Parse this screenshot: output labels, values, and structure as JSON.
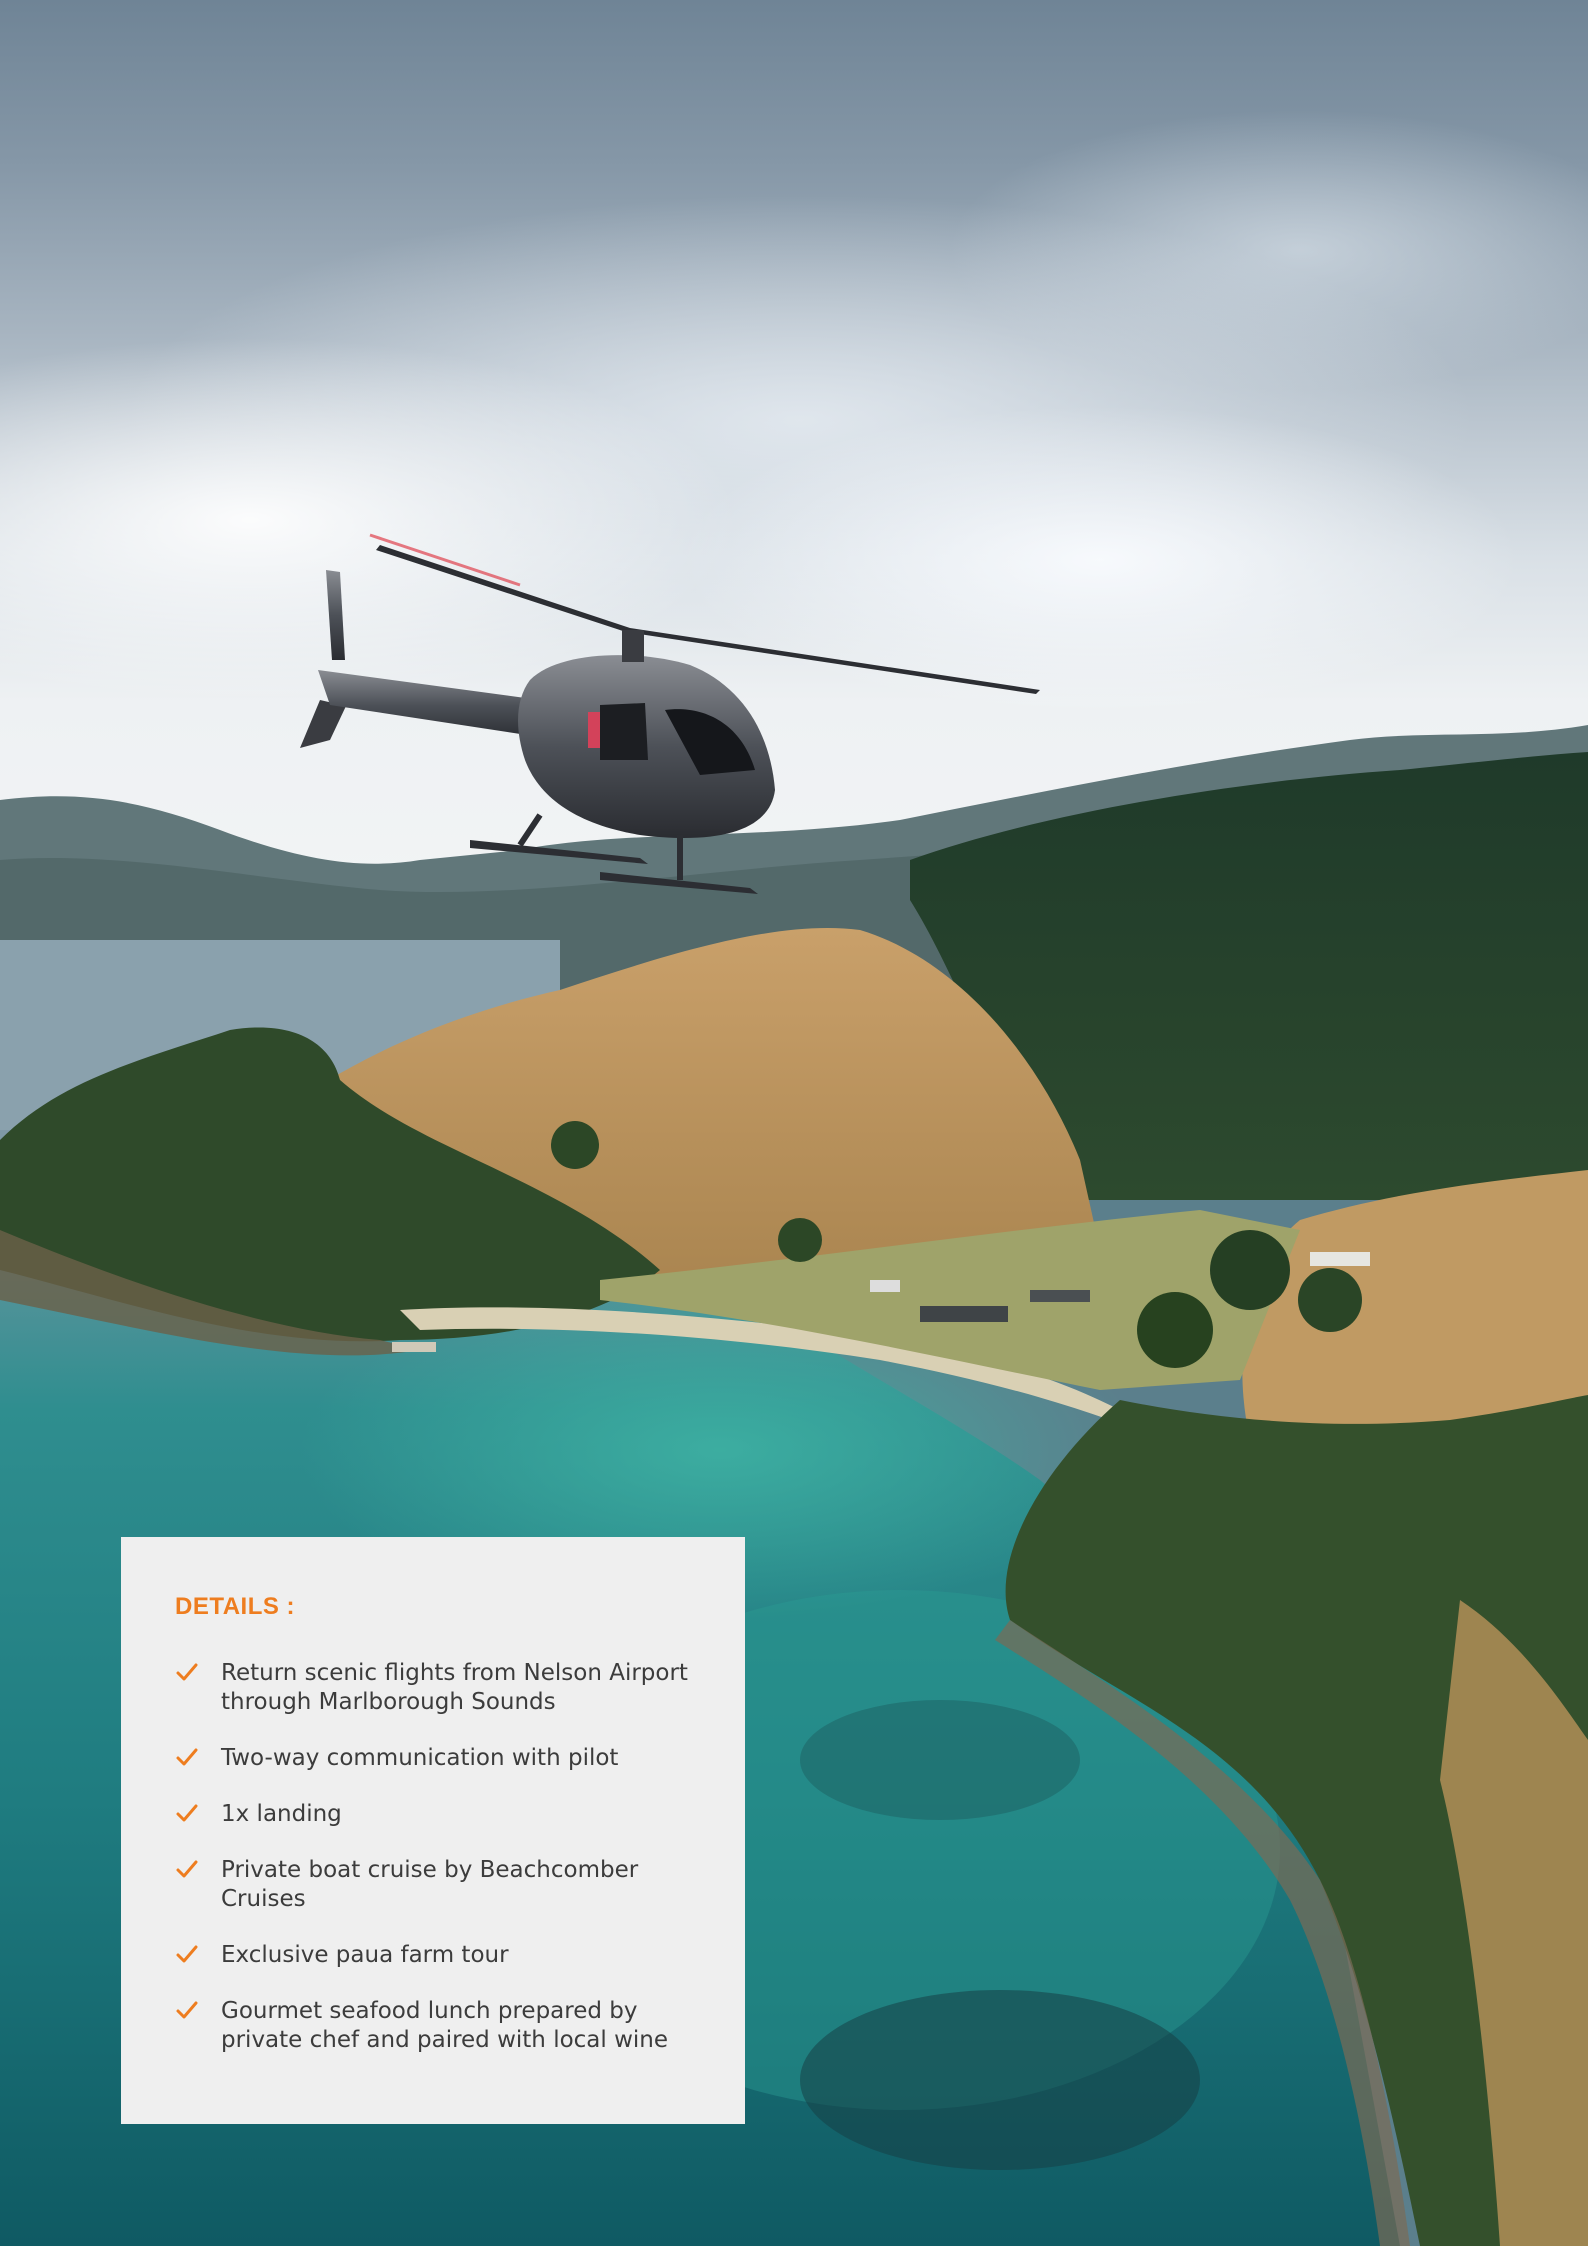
{
  "details": {
    "title": "DETAILS :",
    "accent_color": "#ee7d1f",
    "item_icon": "checkmark-icon",
    "items": [
      {
        "text": "Return scenic flights from Nelson Airport through Marlborough Sounds"
      },
      {
        "text": "Two-way communication with pilot"
      },
      {
        "text": "1x landing"
      },
      {
        "text": "Private boat cruise by Beachcomber Cruises"
      },
      {
        "text": "Exclusive paua farm tour"
      },
      {
        "text": "Gourmet seafood lunch prepared by private chef and paired with local wine"
      }
    ]
  }
}
